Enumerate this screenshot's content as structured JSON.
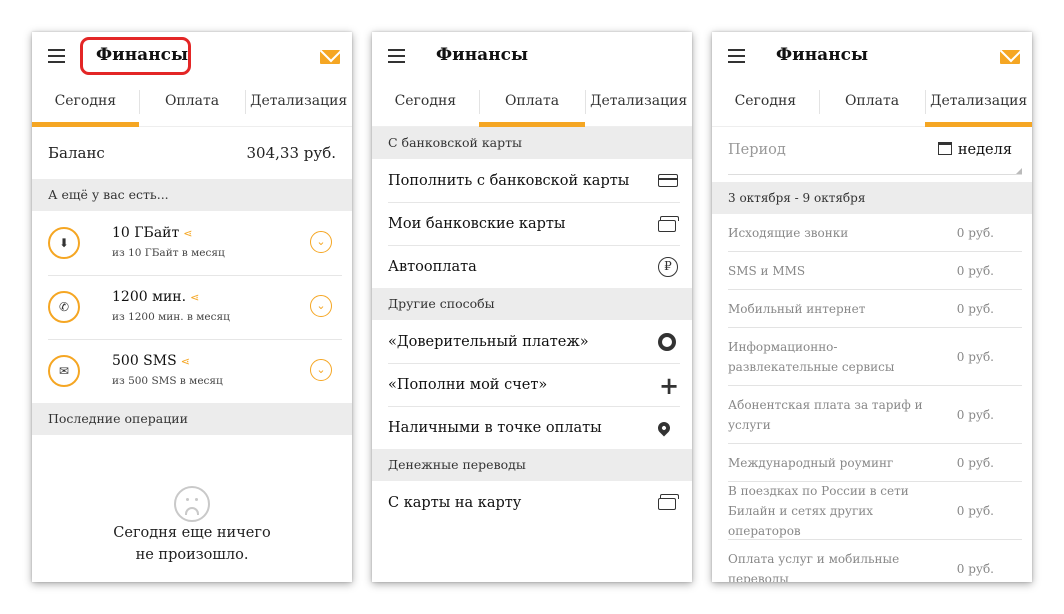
{
  "app": {
    "title": "Финансы",
    "tabs": [
      "Сегодня",
      "Оплата",
      "Детализация"
    ]
  },
  "today": {
    "balance_label": "Баланс",
    "balance_value": "304,33 руб.",
    "extra_header": "А ещё у вас есть...",
    "packages": [
      {
        "icon": "download-icon",
        "title": "10 ГБайт",
        "sub": "из 10 ГБайт в месяц"
      },
      {
        "icon": "phone-icon",
        "title": "1200 мин.",
        "sub": "из 1200 мин. в месяц"
      },
      {
        "icon": "envelope-icon",
        "title": "500 SMS",
        "sub": "из 500 SMS в месяц"
      }
    ],
    "recent_header": "Последние операции",
    "empty_line1": "Сегодня еще ничего",
    "empty_line2": "не произошло."
  },
  "payment": {
    "sections": [
      {
        "header": "С банковской карты",
        "items": [
          {
            "label": "Пополнить с банковской карты",
            "icon": "card-icon"
          },
          {
            "label": "Мои банковские карты",
            "icon": "cards-icon"
          },
          {
            "label": "Автооплата",
            "icon": "ruble-autopay-icon"
          }
        ]
      },
      {
        "header": "Другие способы",
        "items": [
          {
            "label": "«Доверительный платеж»",
            "icon": "lifebuoy-icon"
          },
          {
            "label": "«Пополни мой счет»",
            "icon": "plus-icon"
          },
          {
            "label": "Наличными в точке оплаты",
            "icon": "location-pin-icon"
          }
        ]
      },
      {
        "header": "Денежные переводы",
        "items": [
          {
            "label": "С карты на карту",
            "icon": "cards-icon"
          }
        ]
      }
    ]
  },
  "details": {
    "period_label": "Период",
    "period_value": "неделя",
    "week_range": "3 октября - 9 октября",
    "rows": [
      {
        "label": "Исходящие звонки",
        "amount": "0 руб."
      },
      {
        "label": "SMS и MMS",
        "amount": "0 руб."
      },
      {
        "label": "Мобильный интернет",
        "amount": "0 руб."
      },
      {
        "label": "Информационно-развлекательные сервисы",
        "amount": "0 руб."
      },
      {
        "label": "Абонентская плата за тариф и услуги",
        "amount": "0 руб."
      },
      {
        "label": "Международный роуминг",
        "amount": "0 руб."
      },
      {
        "label": "В поездках по России в сети Билайн и сетях других операторов",
        "amount": "0 руб."
      },
      {
        "label": "Оплата услуг и мобильные переводы",
        "amount": "0 руб."
      }
    ]
  },
  "colors": {
    "accent": "#f5a623",
    "highlight": "#e32626",
    "section_bg": "#ececec"
  }
}
